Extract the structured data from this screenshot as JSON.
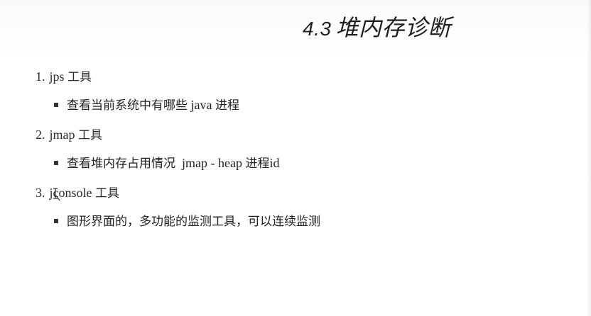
{
  "slide": {
    "title_number": "4.3",
    "title_text": "堆内存诊断",
    "items": [
      {
        "number": "1.",
        "label_latin": "jps",
        "label_cn": "工具",
        "sub_cn": "查看当前系统中有哪些",
        "sub_latin": "java",
        "sub_cn2": "进程",
        "sub_tail": ""
      },
      {
        "number": "2.",
        "label_latin": "jmap",
        "label_cn": "工具",
        "sub_cn": "查看堆内存占用情况",
        "sub_latin": "jmap - heap",
        "sub_cn2": "进程",
        "sub_tail": "id"
      },
      {
        "number": "3.",
        "label_latin": "jconsole",
        "label_cn": "工具",
        "sub_cn": "图形界面的，多功能的监测工具，可以连续监测",
        "sub_latin": "",
        "sub_cn2": "",
        "sub_tail": ""
      }
    ]
  },
  "icons": {
    "cursor": "text-cursor-icon",
    "bullet": "square-bullet-icon"
  }
}
